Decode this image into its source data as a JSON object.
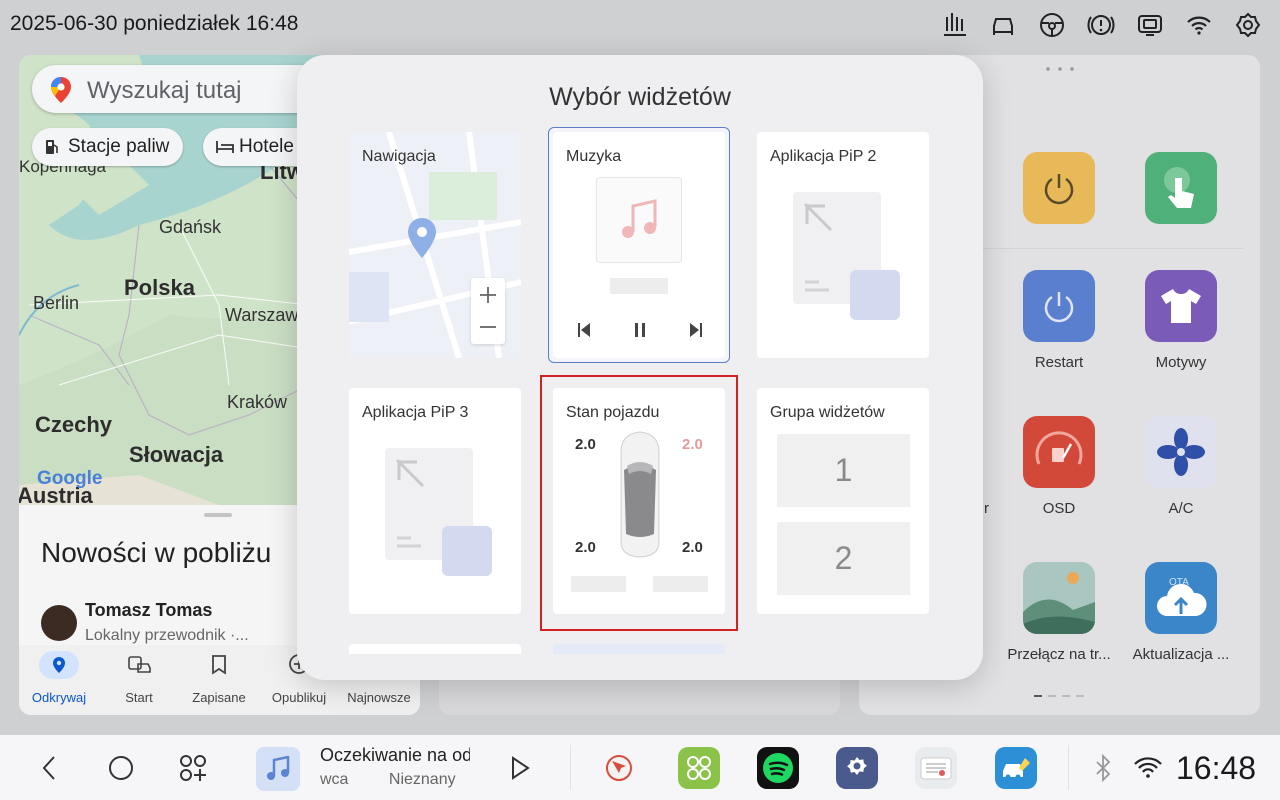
{
  "status_bar": {
    "datetime": "2025-06-30 poniedziałek 16:48",
    "icons": [
      "heat-icon",
      "car-icon",
      "steering-wheel-icon",
      "warning-icon",
      "display-icon",
      "wifi-icon",
      "gear-icon"
    ]
  },
  "maps": {
    "search_placeholder": "Wyszukaj tutaj",
    "chips": [
      "Stacje paliw",
      "Hotele"
    ],
    "labels": {
      "kopenhaga": "Kopenhaga",
      "litwa": "Litw",
      "gdansk": "Gdańsk",
      "polska": "Polska",
      "berlin": "Berlin",
      "warszawa": "Warszaw",
      "krakow": "Kraków",
      "czechy": "Czechy",
      "slowacja": "Słowacja",
      "austria": "Austria",
      "google": "Google"
    },
    "nearby_title": "Nowości w pobliżu",
    "user_name": "Tomasz Tomas",
    "user_subtitle": "Lokalny przewodnik ·...",
    "nav_tabs": [
      "Odkrywaj",
      "Start",
      "Zapisane",
      "Opublikuj",
      "Najnowsze"
    ]
  },
  "right_panel": {
    "apps": [
      {
        "label": "Restart",
        "color": "#5b7fcf"
      },
      {
        "label": "Motywy",
        "color": "#7a5cb8"
      },
      {
        "label": "r",
        "color": ""
      },
      {
        "label": "OSD",
        "color": "#d2493a"
      },
      {
        "label": "A/C",
        "color": "#dfe2ee"
      },
      {
        "label": "Przełącz na tr...",
        "color": "#9bb8a0"
      },
      {
        "label": "Aktualizacja ...",
        "color": "#3a86c8"
      }
    ]
  },
  "dialog": {
    "title": "Wybór widżetów",
    "widgets": {
      "nawigacja": "Nawigacja",
      "muzyka": "Muzyka",
      "pip2": "Aplikacja PiP 2",
      "pip3": "Aplikacja PiP 3",
      "stan": "Stan pojazdu",
      "grupa": "Grupa widżetów"
    },
    "tires": {
      "front_left": "2.0",
      "front_right": "2.0",
      "rear_left": "2.0",
      "rear_right": "2.0"
    },
    "group_items": [
      "1",
      "2"
    ]
  },
  "dock": {
    "media_title": "Oczekiwanie na odtw",
    "media_sub": "wca Nieznany",
    "clock": "16:48"
  }
}
